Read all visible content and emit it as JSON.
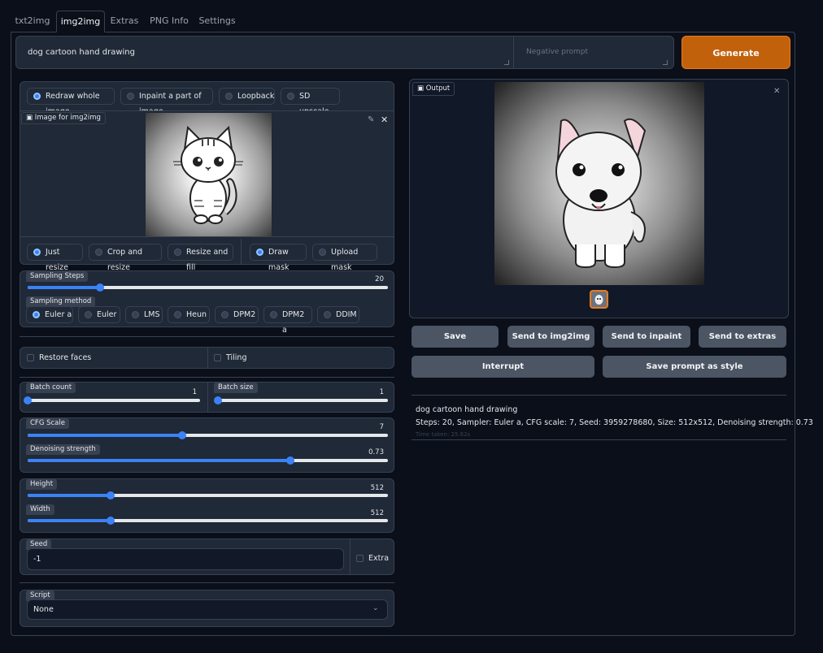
{
  "tabs": [
    "txt2img",
    "img2img",
    "Extras",
    "PNG Info",
    "Settings"
  ],
  "prompt": {
    "value": "dog cartoon hand drawing",
    "negative_placeholder": "Negative prompt"
  },
  "generate_label": "Generate",
  "mode_radios": [
    "Redraw whole image",
    "Inpaint a part of image",
    "Loopback",
    "SD upscale"
  ],
  "image_label": "Image for img2img",
  "resize_radios": [
    "Just resize",
    "Crop and resize",
    "Resize and fill"
  ],
  "mask_radios": [
    "Draw mask",
    "Upload mask"
  ],
  "sampling_steps": {
    "label": "Sampling Steps",
    "value": "20",
    "fraction": 0.2
  },
  "sampling_method": {
    "label": "Sampling method",
    "options": [
      "Euler a",
      "Euler",
      "LMS",
      "Heun",
      "DPM2",
      "DPM2 a",
      "DDIM"
    ],
    "selected": "Euler a"
  },
  "restore_faces": "Restore faces",
  "tiling": "Tiling",
  "batch_count": {
    "label": "Batch count",
    "value": "1",
    "fraction": 0.0
  },
  "batch_size": {
    "label": "Batch size",
    "value": "1",
    "fraction": 0.0
  },
  "cfg_scale": {
    "label": "CFG Scale",
    "value": "7",
    "fraction": 0.43
  },
  "denoising": {
    "label": "Denoising strength",
    "value": "0.73",
    "fraction": 0.73
  },
  "height": {
    "label": "Height",
    "value": "512",
    "fraction": 0.23
  },
  "width": {
    "label": "Width",
    "value": "512",
    "fraction": 0.23
  },
  "seed": {
    "label": "Seed",
    "value": "-1",
    "extra": "Extra"
  },
  "script": {
    "label": "Script",
    "value": "None"
  },
  "output_label": "Output",
  "output_buttons": [
    "Save",
    "Send to img2img",
    "Send to inpaint",
    "Send to extras"
  ],
  "interrupt_label": "Interrupt",
  "save_style_label": "Save prompt as style",
  "info": {
    "prompt": "dog cartoon hand drawing",
    "params": "Steps: 20, Sampler: Euler a, CFG scale: 7, Seed: 3959278680, Size: 512x512, Denoising strength: 0.73",
    "time": "Time taken: 25.62s"
  },
  "colors": {
    "accent": "#3b82f6",
    "generate": "#c2610c",
    "panel": "#1f2937",
    "background": "#0b0f19"
  }
}
